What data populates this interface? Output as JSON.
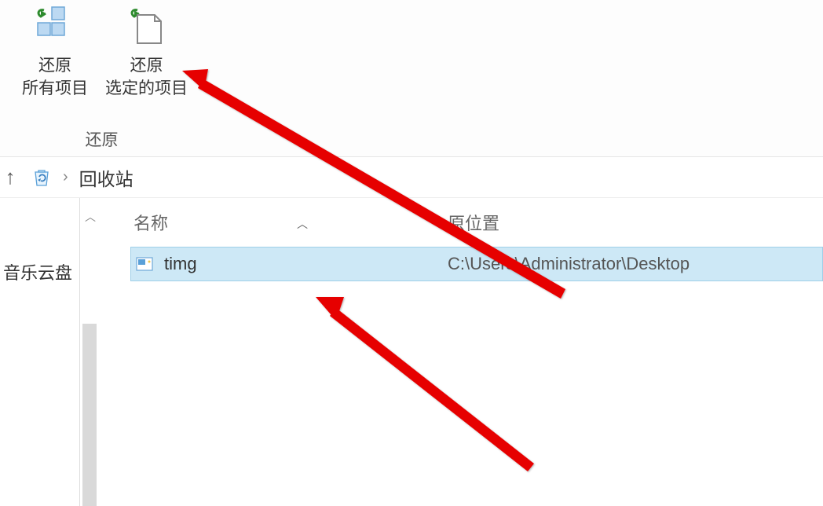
{
  "ribbon": {
    "restore_all": {
      "line1": "还原",
      "line2": "所有项目"
    },
    "restore_selected": {
      "line1": "还原",
      "line2": "选定的项目"
    },
    "group_label": "还原"
  },
  "breadcrumb": {
    "current": "回收站"
  },
  "sidebar": {
    "item": "音乐云盘"
  },
  "columns": {
    "name": "名称",
    "location": "原位置"
  },
  "rows": [
    {
      "name": "timg",
      "location": "C:\\Users\\Administrator\\Desktop"
    }
  ]
}
